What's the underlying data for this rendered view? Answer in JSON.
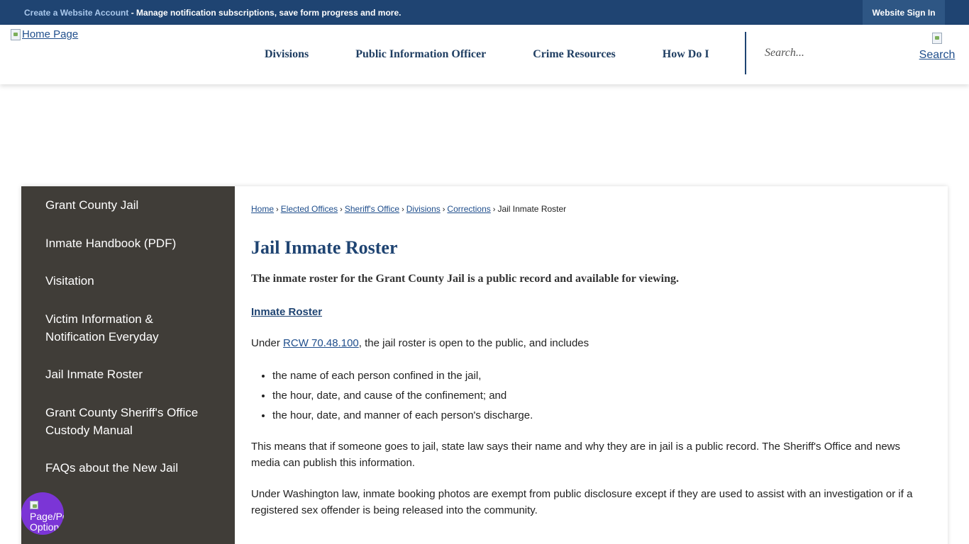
{
  "topbar": {
    "create_account_link": "Create a Website Account",
    "create_account_text": " - Manage notification subscriptions, save form progress and more.",
    "sign_in": "Website Sign In"
  },
  "header": {
    "home_logo_alt": "Home Page",
    "nav": [
      "Divisions",
      "Public Information Officer",
      "Crime Resources",
      "How Do I"
    ],
    "search_placeholder": "Search...",
    "search_button_alt": "Search"
  },
  "sidebar": {
    "items": [
      "Grant County Jail",
      "Inmate Handbook (PDF)",
      "Visitation",
      "Victim Information & Notification Everyday",
      "Jail Inmate Roster",
      "Grant County Sheriff's Office Custody Manual",
      "FAQs about the New Jail"
    ]
  },
  "breadcrumb": {
    "links": [
      "Home",
      "Elected Offices",
      "Sheriff's Office",
      "Divisions",
      "Corrections"
    ],
    "current": "Jail Inmate Roster",
    "separator": "›"
  },
  "main": {
    "title": "Jail Inmate Roster",
    "lead": "The inmate roster for the Grant County Jail is a public record and available for viewing.",
    "roster_link": "Inmate Roster",
    "para1_prefix": "Under ",
    "para1_link": "RCW 70.48.100",
    "para1_suffix": ", the jail roster is open to the public, and includes",
    "bullets": [
      "the name of each person confined in the jail,",
      "the hour, date, and cause of the confinement; and",
      "the hour, date, and manner of each person's discharge."
    ],
    "para2": "This means that if someone goes to jail, state law says their name and why they are in jail is a public record. The Sheriff's Office and news media can publish this information.",
    "para3": "Under Washington law, inmate booking photos are exempt from public disclosure except if they are used to assist with an investigation or if a registered sex offender is being released into the community."
  },
  "page_options": {
    "label": "Page/Personal Options"
  },
  "colors": {
    "topbar": "#1f4472",
    "sidebar": "#403d38",
    "title": "#1f4472",
    "page_options": "#7b35d6"
  }
}
